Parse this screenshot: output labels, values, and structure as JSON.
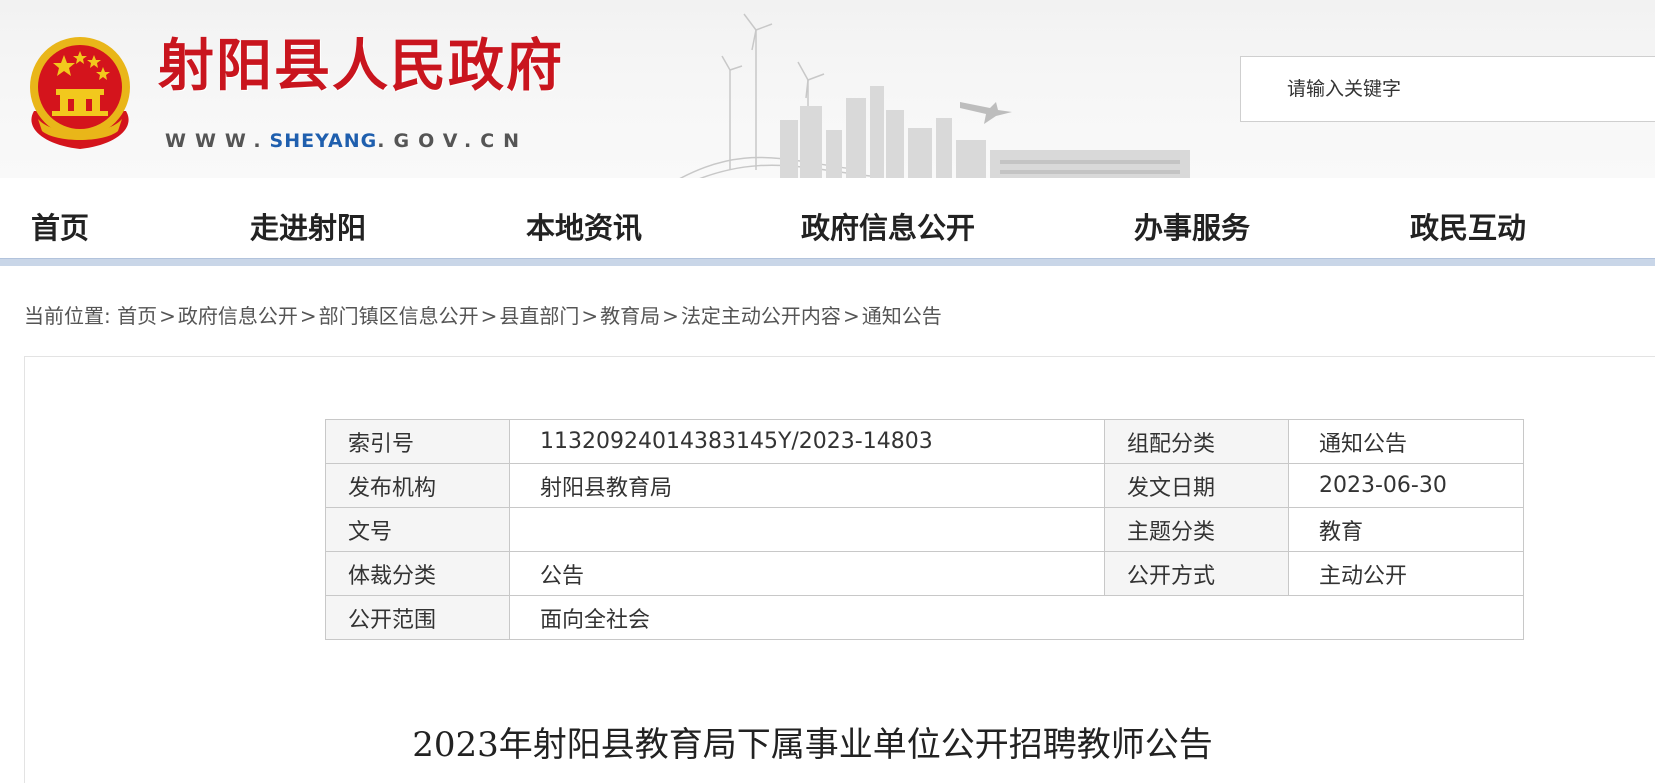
{
  "header": {
    "site_title": "射阳县人民政府",
    "url_prefix": "WWW.",
    "url_highlight": "SHEYANG",
    "url_suffix": ".GOV.CN",
    "search_placeholder": "请输入关键字",
    "colors": {
      "title_red": "#c9151e",
      "url_blue": "#1f5fae"
    }
  },
  "nav": {
    "items": [
      "首页",
      "走进射阳",
      "本地资讯",
      "政府信息公开",
      "办事服务",
      "政民互动"
    ]
  },
  "breadcrumb": {
    "prefix": "当前位置:",
    "items": [
      "首页",
      "政府信息公开",
      "部门镇区信息公开",
      "县直部门",
      "教育局",
      "法定主动公开内容",
      "通知公告"
    ]
  },
  "meta": {
    "index_no_label": "索引号",
    "index_no_value": "11320924014383145Y/2023-14803",
    "category_label": "组配分类",
    "category_value": "通知公告",
    "issuer_label": "发布机构",
    "issuer_value": "射阳县教育局",
    "date_label": "发文日期",
    "date_value": "2023-06-30",
    "doc_no_label": "文号",
    "doc_no_value": "",
    "topic_label": "主题分类",
    "topic_value": "教育",
    "genre_label": "体裁分类",
    "genre_value": "公告",
    "mode_label": "公开方式",
    "mode_value": "主动公开",
    "scope_label": "公开范围",
    "scope_value": "面向全社会"
  },
  "article": {
    "title": "2023年射阳县教育局下属事业单位公开招聘教师公告"
  }
}
